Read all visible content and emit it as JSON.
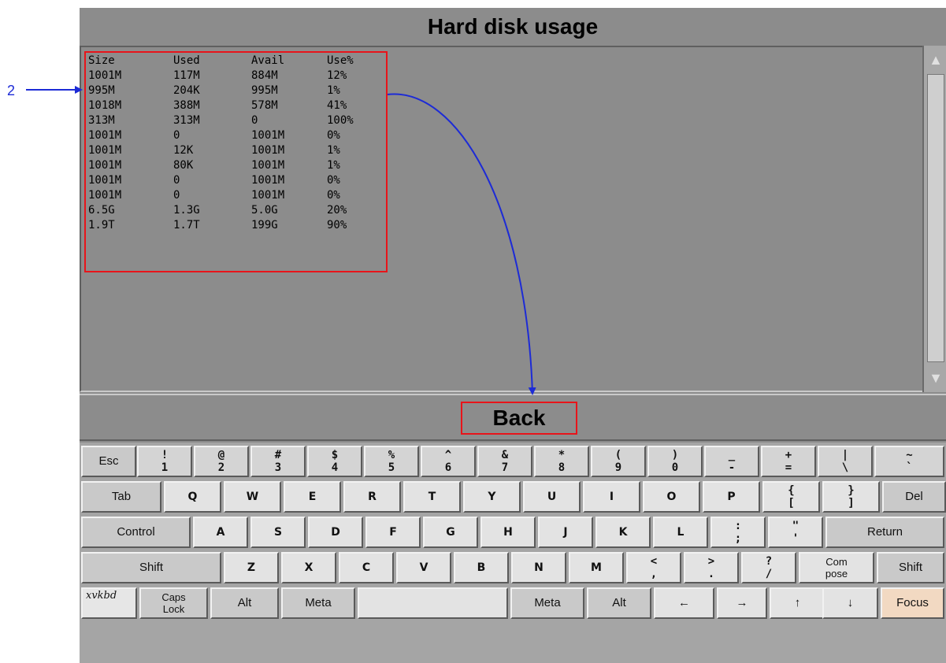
{
  "window": {
    "title": "Hard disk usage"
  },
  "disk_table": {
    "headers": [
      "Size",
      "Used",
      "Avail",
      "Use%"
    ],
    "rows": [
      [
        "1001M",
        "117M",
        "884M",
        "12%"
      ],
      [
        "995M",
        "204K",
        "995M",
        "1%"
      ],
      [
        "1018M",
        "388M",
        "578M",
        "41%"
      ],
      [
        "313M",
        "313M",
        "0",
        "100%"
      ],
      [
        "1001M",
        "0",
        "1001M",
        "0%"
      ],
      [
        "1001M",
        "12K",
        "1001M",
        "1%"
      ],
      [
        "1001M",
        "80K",
        "1001M",
        "1%"
      ],
      [
        "1001M",
        "0",
        "1001M",
        "0%"
      ],
      [
        "1001M",
        "0",
        "1001M",
        "0%"
      ],
      [
        "6.5G",
        "1.3G",
        "5.0G",
        "20%"
      ],
      [
        "1.9T",
        "1.7T",
        "199G",
        "90%"
      ]
    ]
  },
  "buttons": {
    "back": "Back"
  },
  "annotation": {
    "label": "2",
    "color": "#1d2bd6",
    "highlight_color": "#e8141a"
  },
  "scrollbar": {
    "up_icon": "triangle-up-icon",
    "down_icon": "triangle-down-icon"
  },
  "keyboard": {
    "row1": [
      {
        "top": "",
        "bottom": "Esc"
      },
      {
        "top": "!",
        "bottom": "1"
      },
      {
        "top": "@",
        "bottom": "2"
      },
      {
        "top": "#",
        "bottom": "3"
      },
      {
        "top": "$",
        "bottom": "4"
      },
      {
        "top": "%",
        "bottom": "5"
      },
      {
        "top": "^",
        "bottom": "6"
      },
      {
        "top": "&",
        "bottom": "7"
      },
      {
        "top": "*",
        "bottom": "8"
      },
      {
        "top": "(",
        "bottom": "9"
      },
      {
        "top": ")",
        "bottom": "0"
      },
      {
        "top": "_",
        "bottom": "-"
      },
      {
        "top": "+",
        "bottom": "="
      },
      {
        "top": "|",
        "bottom": "\\"
      },
      {
        "top": "~",
        "bottom": "`"
      }
    ],
    "row2": [
      "Tab",
      "Q",
      "W",
      "E",
      "R",
      "T",
      "Y",
      "U",
      "I",
      "O",
      "P",
      "{",
      "}",
      "Del"
    ],
    "row2_bottoms": [
      "",
      "",
      "",
      "",
      "",
      "",
      "",
      "",
      "",
      "",
      "",
      "[",
      "]",
      ""
    ],
    "row3": [
      "Control",
      "A",
      "S",
      "D",
      "F",
      "G",
      "H",
      "J",
      "K",
      "L",
      ":",
      "\"",
      "Return"
    ],
    "row3_bottoms": [
      "",
      "",
      "",
      "",
      "",
      "",
      "",
      "",
      "",
      "",
      ";",
      "'",
      ""
    ],
    "row4": [
      "Shift",
      "Z",
      "X",
      "C",
      "V",
      "B",
      "N",
      "M",
      "<",
      ">",
      "?",
      "Com",
      "Shift"
    ],
    "row4_bottoms": [
      "",
      "",
      "",
      "",
      "",
      "",
      "",
      "",
      ",",
      ".",
      "/",
      "pose",
      ""
    ],
    "row5": [
      "xvkbd",
      "Caps",
      "Alt",
      "Meta",
      "",
      "Meta",
      "Alt",
      "←",
      "→",
      "↑",
      "↓",
      "Focus"
    ],
    "row5_bottoms": [
      "",
      "Lock",
      "",
      "",
      "",
      "",
      "",
      "",
      "",
      "",
      "",
      ""
    ]
  }
}
